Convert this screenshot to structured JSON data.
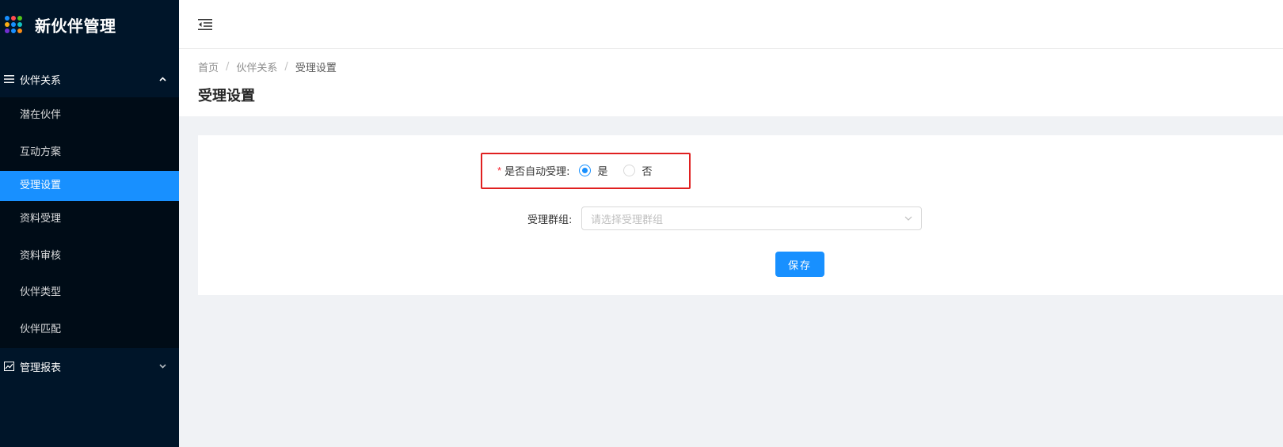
{
  "app": {
    "title": "新伙伴管理",
    "logo_colors": [
      "#1890ff",
      "#ff4d4f",
      "#52c41a",
      "#faad14",
      "#1890ff",
      "#13c2c2",
      "#722ed1",
      "#1890ff",
      "#fa8c16"
    ]
  },
  "sidebar": {
    "group1": {
      "icon": "menu-lines-icon",
      "label": "伙伴关系",
      "expanded": true,
      "items": [
        {
          "label": "潜在伙伴",
          "active": false
        },
        {
          "label": "互动方案",
          "active": false
        },
        {
          "label": "受理设置",
          "active": true
        },
        {
          "label": "资料受理",
          "active": false
        },
        {
          "label": "资料审核",
          "active": false
        },
        {
          "label": "伙伴类型",
          "active": false
        },
        {
          "label": "伙伴匹配",
          "active": false
        }
      ]
    },
    "group2": {
      "icon": "chart-icon",
      "label": "管理报表",
      "expanded": false
    }
  },
  "header": {
    "fold_icon": "menu-fold-icon"
  },
  "breadcrumb": {
    "items": [
      "首页",
      "伙伴关系",
      "受理设置"
    ],
    "separator": "/"
  },
  "page": {
    "title": "受理设置"
  },
  "form": {
    "auto_accept": {
      "required_mark": "*",
      "label": "是否自动受理:",
      "options": [
        {
          "label": "是",
          "checked": true
        },
        {
          "label": "否",
          "checked": false
        }
      ]
    },
    "group": {
      "label": "受理群组:",
      "placeholder": "请选择受理群组"
    },
    "save_label": "保存"
  },
  "colors": {
    "sidebar_bg": "#001529",
    "submenu_bg": "#000c17",
    "primary": "#1890ff",
    "highlight": "#e02020"
  }
}
